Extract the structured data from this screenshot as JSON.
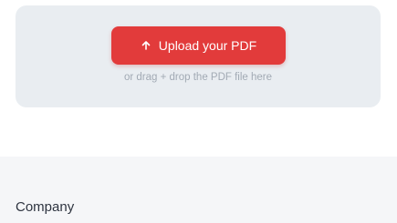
{
  "upload": {
    "button_label": "Upload your PDF",
    "button_icon": "upload-icon",
    "hint": "or drag + drop the PDF file here",
    "accent_color": "#e23b3b"
  },
  "footer": {
    "heading": "Company"
  }
}
